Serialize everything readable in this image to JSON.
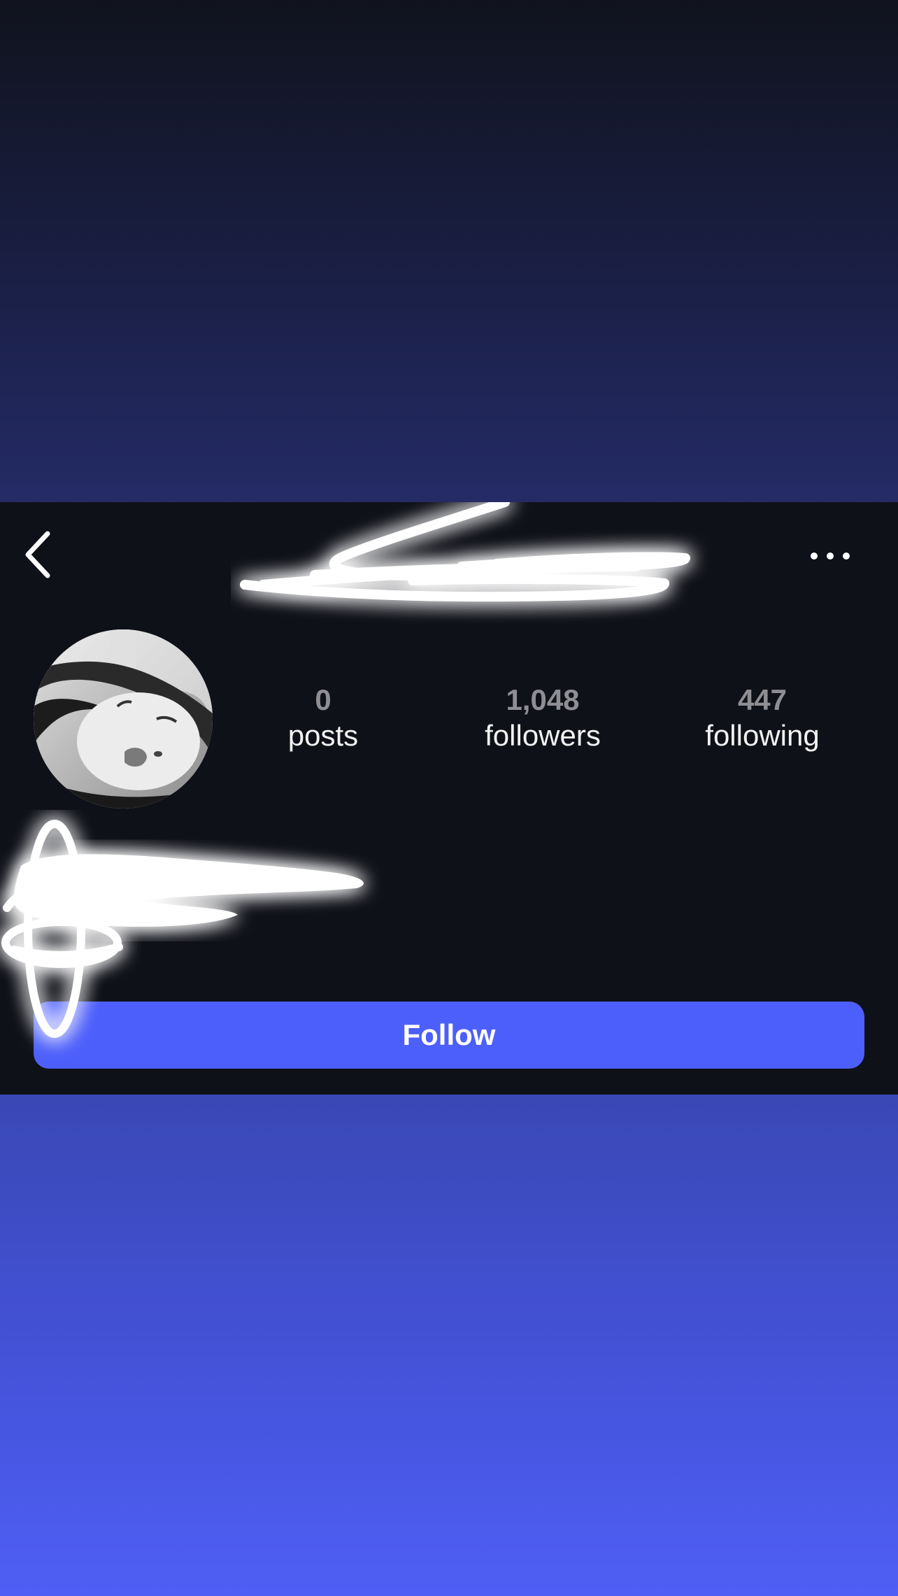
{
  "header": {
    "back_icon": "chevron-left-icon",
    "more_icon": "ellipsis-icon"
  },
  "stats": {
    "posts": {
      "count": "0",
      "label": "posts"
    },
    "followers": {
      "count": "1,048",
      "label": "followers"
    },
    "following": {
      "count": "447",
      "label": "following"
    }
  },
  "actions": {
    "follow_label": "Follow"
  },
  "colors": {
    "accent": "#4d5ffa",
    "card_background": "#0f1118",
    "count_text": "#8e8e93",
    "label_text": "#f2f2f2"
  }
}
